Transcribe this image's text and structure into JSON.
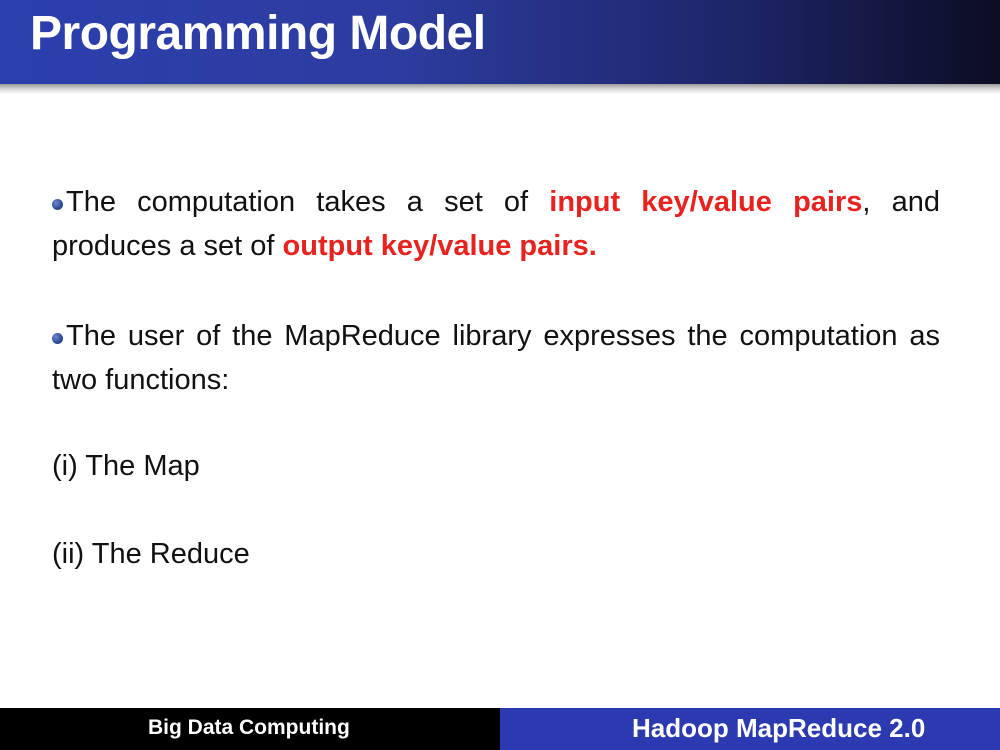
{
  "slide": {
    "title": "Programming Model",
    "paragraph1": {
      "text_a": "The computation takes a set of ",
      "highlight_a": "input key/value pairs",
      "text_b": ", and produces a set of ",
      "highlight_b": "output key/value pairs."
    },
    "paragraph2": {
      "text": "The user of the MapReduce library expresses the computation as two functions:"
    },
    "items": [
      "(i) The Map",
      "(ii) The Reduce"
    ]
  },
  "footer": {
    "left_label": "Big Data Computing",
    "right_label": "Hadoop MapReduce 2.0"
  },
  "colors": {
    "title_bar": "#2b3fae",
    "highlight": "#e8231f",
    "footer_left": "#000000",
    "footer_right": "#2b3ab0"
  }
}
